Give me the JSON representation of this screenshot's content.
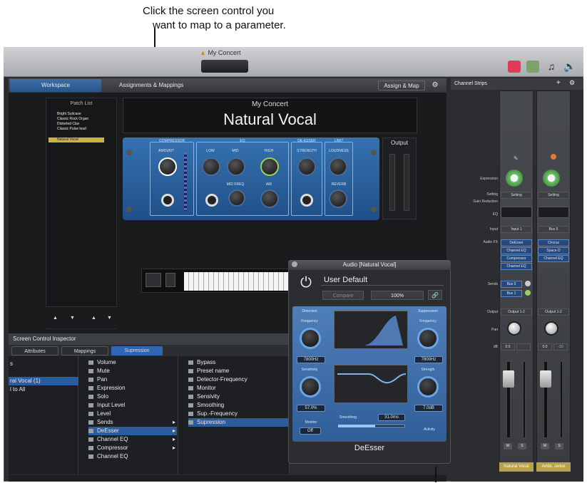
{
  "caption": {
    "line1": "Click the screen control you",
    "line2": "want to map to a parameter."
  },
  "window": {
    "title": "My Concert"
  },
  "tabs": [
    {
      "label": "Workspace"
    },
    {
      "label": "Assignments & Mappings"
    }
  ],
  "toolbar": {
    "assign_map": "Assign & Map"
  },
  "patch_list": {
    "title": "Patch List",
    "items": [
      "Bright Suitcase",
      "Classic Rock Organ",
      "Distorted Clav",
      "Classic Pulse lead",
      "Natural Vocal"
    ],
    "selected_index": 4
  },
  "concert": {
    "title": "My Concert",
    "patch": "Natural Vocal"
  },
  "plugin_sections": {
    "compressor": "COMPRESSOR",
    "eq": "EQ",
    "deesser": "DE-ESSER",
    "limit": "LIMIT"
  },
  "plugin_knobs": [
    "AMOUNT",
    "LOW",
    "MID",
    "HIGH",
    "MID FREQ",
    "AIR",
    "STRENGTH",
    "LOUDNESS",
    "REVERB"
  ],
  "output_label": "Output",
  "inspector": {
    "title": "Screen Control Inspector",
    "tabs": [
      "Attributes",
      "Mappings",
      "Supression"
    ],
    "active_tab": 2,
    "col1": [
      "s",
      "ral Vocal (1)",
      "l to All"
    ],
    "col2": [
      "Volume",
      "Mute",
      "Pan",
      "Expression",
      "Solo",
      "Input Level",
      "Level",
      "Sends",
      "DeEsser",
      "Channel EQ",
      "Compressor",
      "Channel EQ"
    ],
    "col3": [
      "Bypass",
      "Preset name",
      "Detector-Frequency",
      "Monitor",
      "Sensivity",
      "Smoothing",
      "Sup.-Frequency",
      "Supression"
    ]
  },
  "deesser": {
    "window_title": "Audio [Natural Vocal]",
    "preset": "User Default",
    "compare": "Compare",
    "zoom": "100%",
    "detection": "Detection",
    "suppression": "Suppression",
    "frequency": "Frequency",
    "sensitivity": "Sensitivity",
    "strength": "Strength",
    "smoothing": "Smoothing",
    "monitor": "Monitor",
    "activity": "Activity",
    "det_freq_val": "7800Hz",
    "sup_freq_val": "7800Hz",
    "sens_val": "57.0%",
    "strength_val": "7.0dB",
    "smooth_val": "31.0ms",
    "monitor_val": "Off",
    "name": "DeEsser"
  },
  "channel_strips": {
    "title": "Channel Strips",
    "labels": [
      "Expression",
      "Setting",
      "Gain Reduction",
      "EQ",
      "Input",
      "Audio FX",
      "Sends",
      "Output",
      "Pan",
      "dB"
    ],
    "strip1": {
      "setting": "Setting",
      "input": "Input 1",
      "fx": [
        "DeEsser",
        "Channel EQ",
        "Compressor",
        "Channel EQ"
      ],
      "sends": [
        "Bus 5",
        "Bus 1"
      ],
      "output": "Output 1-2",
      "db1": "0.0",
      "name": "Natural Vocal"
    },
    "strip2": {
      "setting": "Setting",
      "input": "Bus 5",
      "fx": [
        "Chorus",
        "Space D",
        "Channel EQ"
      ],
      "output": "Output 1-2",
      "db1": "0.0",
      "db2": "-10",
      "name": "Ambi...ience"
    }
  }
}
